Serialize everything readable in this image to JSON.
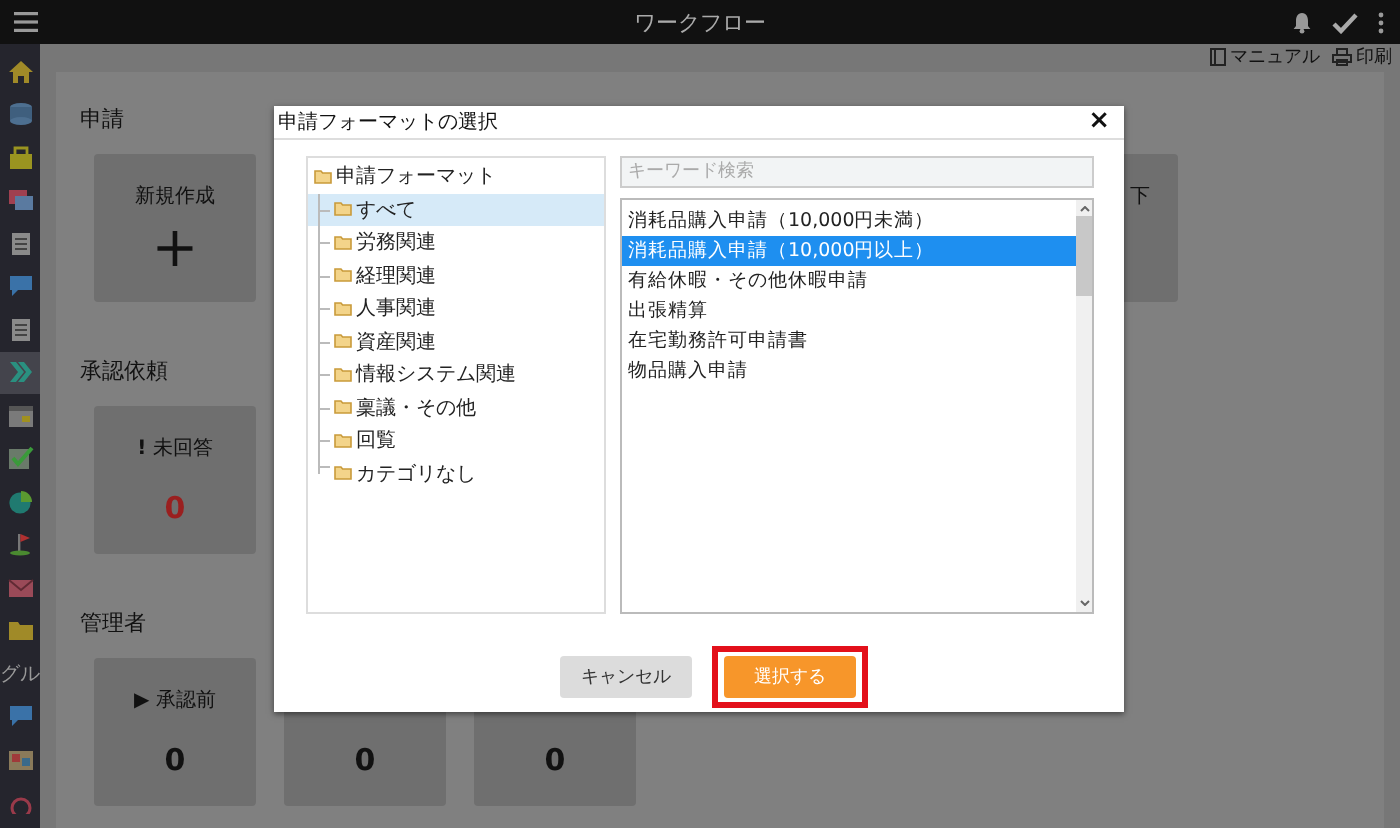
{
  "app_bar": {
    "title": "ワークフロー"
  },
  "sidebar": {
    "items": [
      {
        "kind": "icon",
        "selected": false
      },
      {
        "kind": "icon",
        "selected": false
      },
      {
        "kind": "icon",
        "selected": false
      },
      {
        "kind": "icon",
        "selected": false
      },
      {
        "kind": "icon",
        "selected": false
      },
      {
        "kind": "icon",
        "selected": false
      },
      {
        "kind": "icon",
        "selected": false
      },
      {
        "kind": "icon",
        "selected": true
      },
      {
        "kind": "icon",
        "selected": false
      },
      {
        "kind": "icon",
        "selected": false
      },
      {
        "kind": "icon",
        "selected": false
      },
      {
        "kind": "icon",
        "selected": false
      },
      {
        "kind": "icon",
        "selected": false
      },
      {
        "kind": "icon",
        "selected": false
      },
      {
        "kind": "text",
        "label": "グル",
        "selected": false
      },
      {
        "kind": "icon",
        "selected": false
      },
      {
        "kind": "icon",
        "selected": false
      },
      {
        "kind": "icon",
        "selected": false
      }
    ]
  },
  "toolbar": {
    "links": [
      "マニュアル",
      "印刷"
    ]
  },
  "sections": [
    {
      "title": "申請",
      "cards": [
        {
          "label": "新規作成",
          "value": "+",
          "kind": "action"
        },
        {
          "label": "下",
          "kind": "partial"
        }
      ]
    },
    {
      "title": "承認依頼",
      "cards": [
        {
          "label": "未回答",
          "marker": "!",
          "value": "0",
          "alert": true,
          "kind": "count"
        }
      ]
    },
    {
      "title": "管理者",
      "cards": [
        {
          "label": "承認前",
          "marker": "▶",
          "value": "0",
          "alert": false,
          "kind": "count"
        },
        {
          "value": "0",
          "alert": false,
          "kind": "count"
        },
        {
          "value": "0",
          "alert": false,
          "kind": "count"
        }
      ]
    }
  ],
  "dialog": {
    "title": "申請フォーマットの選択",
    "close": "×",
    "tree": {
      "label": "申請フォーマット",
      "selected": false,
      "children": [
        {
          "label": "すべて",
          "selected": true
        },
        {
          "label": "労務関連",
          "selected": false
        },
        {
          "label": "経理関連",
          "selected": false
        },
        {
          "label": "人事関連",
          "selected": false
        },
        {
          "label": "資産関連",
          "selected": false
        },
        {
          "label": "情報システム関連",
          "selected": false
        },
        {
          "label": "稟議・その他",
          "selected": false
        },
        {
          "label": "回覧",
          "selected": false
        },
        {
          "label": "カテゴリなし",
          "selected": false
        }
      ]
    },
    "search": {
      "placeholder": "キーワード検索"
    },
    "formats": [
      {
        "label": "消耗品購入申請（10,000円未満）",
        "selected": false
      },
      {
        "label": "消耗品購入申請（10,000円以上）",
        "selected": true
      },
      {
        "label": "有給休暇・その他休暇申請",
        "selected": false
      },
      {
        "label": "出張精算",
        "selected": false
      },
      {
        "label": "在宅勤務許可申請書",
        "selected": false
      },
      {
        "label": "物品購入申請",
        "selected": false
      }
    ],
    "buttons": [
      {
        "label": "キャンセル",
        "kind": "secondary",
        "highlighted": false
      },
      {
        "label": "選択する",
        "kind": "primary",
        "highlighted": true
      }
    ]
  }
}
